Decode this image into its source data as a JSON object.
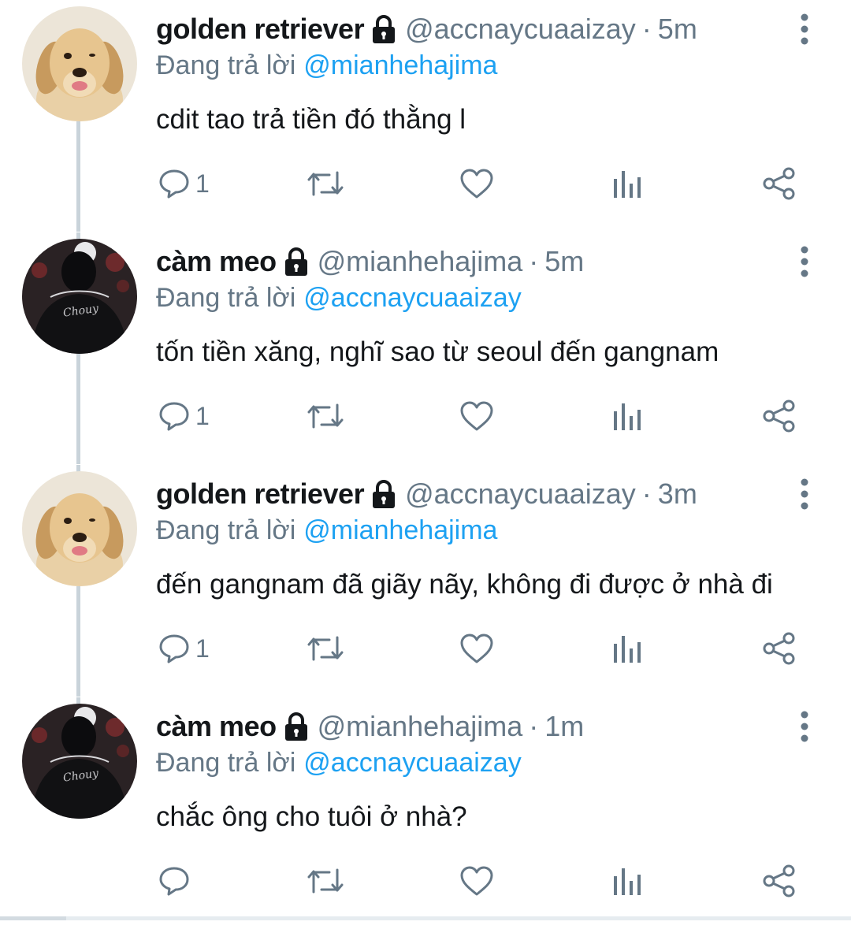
{
  "timeline": {
    "tweets": [
      {
        "avatar": "golden-retriever-avatar",
        "name": "golden retriever",
        "handle": "@accnaycuaaizay",
        "time": "5m",
        "reply_prefix": "Đang trả lời",
        "reply_mention": "@mianhehajima",
        "text": "cdit tao trả tiền đó thằng l",
        "reply_count": "1"
      },
      {
        "avatar": "black-hoodie-avatar",
        "name": "càm meo",
        "handle": "@mianhehajima",
        "time": "5m",
        "reply_prefix": "Đang trả lời",
        "reply_mention": "@accnaycuaaizay",
        "text": "tốn tiền xăng, nghĩ sao từ seoul đến gangnam",
        "reply_count": "1"
      },
      {
        "avatar": "golden-retriever-avatar",
        "name": "golden retriever",
        "handle": "@accnaycuaaizay",
        "time": "3m",
        "reply_prefix": "Đang trả lời",
        "reply_mention": "@mianhehajima",
        "text": "đến gangnam đã giãy nãy, không đi được ở nhà đi",
        "reply_count": "1"
      },
      {
        "avatar": "black-hoodie-avatar",
        "name": "càm meo",
        "handle": "@mianhehajima",
        "time": "1m",
        "reply_prefix": "Đang trả lời",
        "reply_mention": "@accnaycuaaizay",
        "text": "chắc ông cho tuôi ở nhà?",
        "reply_count": ""
      }
    ],
    "separator": "·",
    "icons": {
      "lock": "lock-icon",
      "more": "more-vertical-icon",
      "reply": "reply-icon",
      "retweet": "retweet-icon",
      "like": "heart-icon",
      "analytics": "analytics-icon",
      "share": "share-icon"
    }
  },
  "colors": {
    "name": "#14171a",
    "muted": "#657786",
    "mention": "#1da1f2",
    "thread_line": "#c9d3da"
  }
}
